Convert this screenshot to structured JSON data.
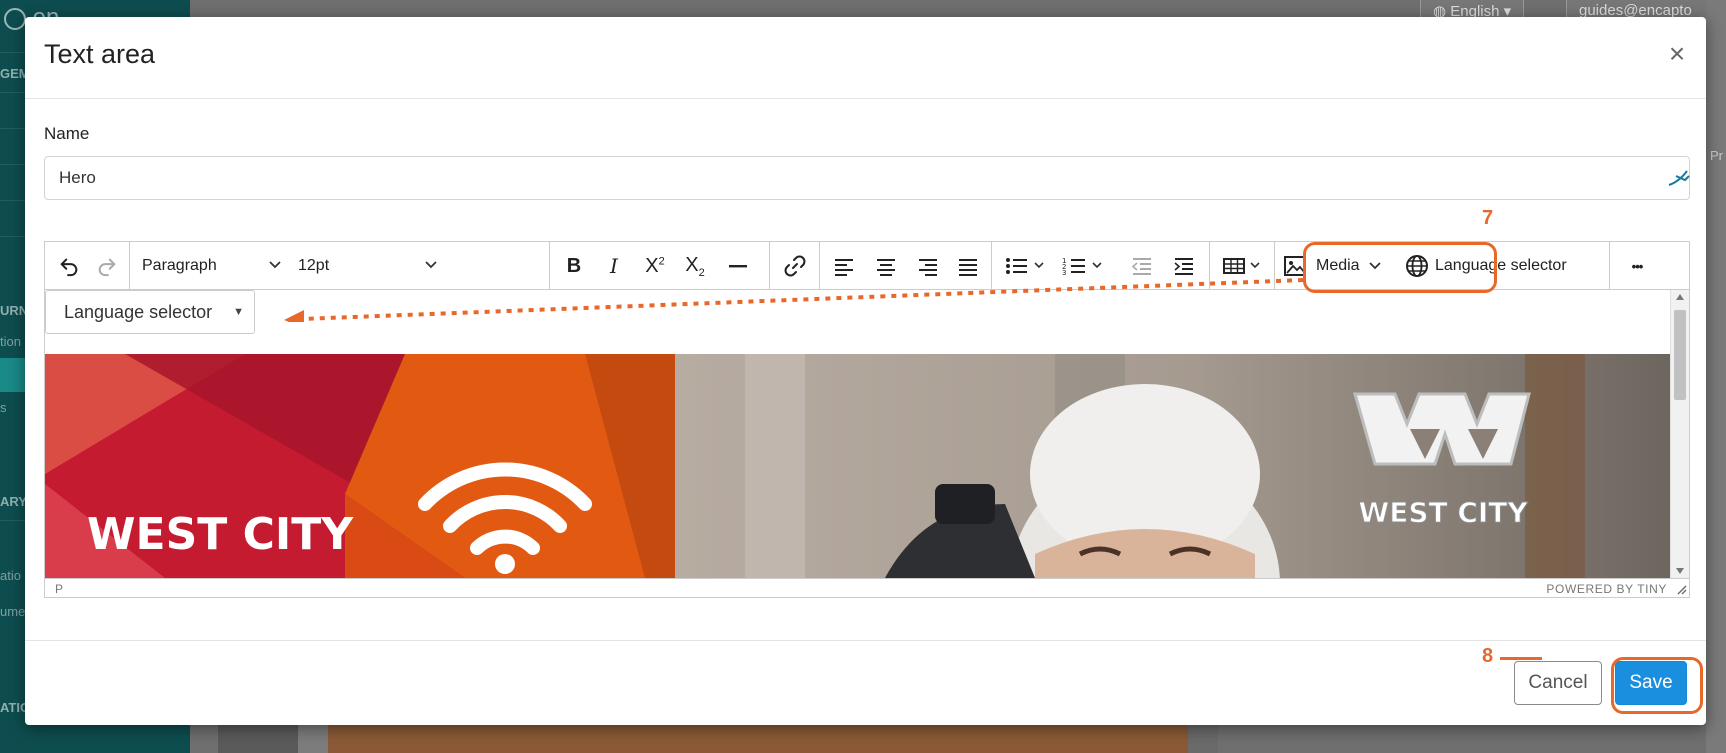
{
  "background": {
    "brand": "en",
    "sidebar_sections": [
      "GEM",
      "URN",
      "ARY",
      "ATIO"
    ],
    "sidebar_items": [
      "tion",
      "s",
      "atio",
      "ume"
    ],
    "top_buttons": [
      "English",
      "guides@encapto"
    ],
    "edge_texts": [
      "Pr"
    ]
  },
  "modal": {
    "title": "Text area",
    "close_symbol": "×",
    "name_label": "Name",
    "name_value": "Hero"
  },
  "toolbar": {
    "block_format": "Paragraph",
    "font_size": "12pt",
    "media_label": "Media",
    "language_selector_label": "Language selector",
    "more_label": "•••"
  },
  "editor": {
    "language_dropdown_label": "Language selector",
    "status_path": "P",
    "status_brand": "POWERED BY TINY",
    "image": {
      "left_logo_text": "WEST CITY",
      "right_logo_text": "WEST CITY"
    }
  },
  "footer": {
    "cancel_label": "Cancel",
    "save_label": "Save"
  },
  "annotations": {
    "step_7": "7",
    "step_8": "8",
    "accent_color": "#e8682a"
  },
  "colors": {
    "sidebar": "#0e4d4f",
    "primary_button": "#1a8fdf",
    "annotation": "#e8682a"
  }
}
